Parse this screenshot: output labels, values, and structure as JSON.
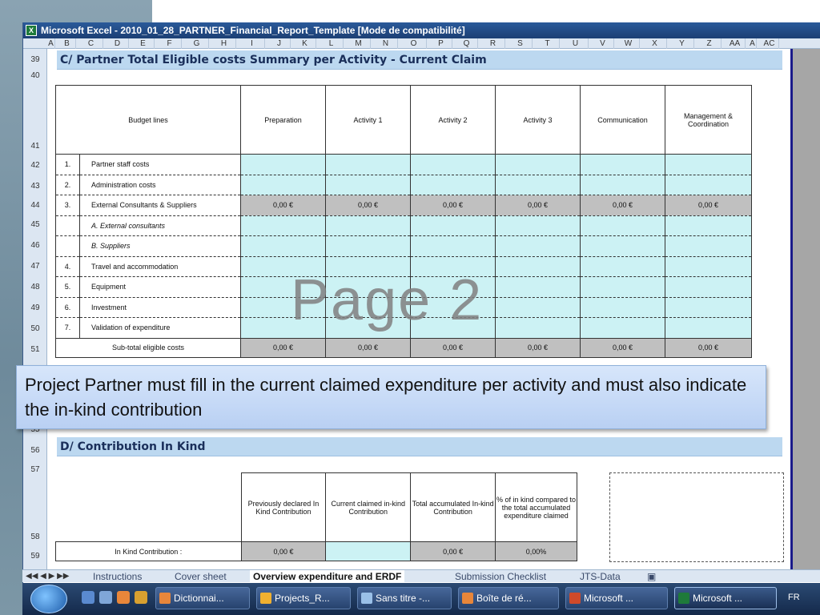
{
  "window": {
    "title": "Microsoft Excel - 2010_01_28_PARTNER_Financial_Report_Template  [Mode de compatibilité]"
  },
  "columns": [
    "A",
    "B",
    "C",
    "D",
    "E",
    "F",
    "G",
    "H",
    "I",
    "J",
    "K",
    "L",
    "M",
    "N",
    "O",
    "P",
    "Q",
    "R",
    "S",
    "T",
    "U",
    "V",
    "W",
    "X",
    "Y",
    "Z",
    "AA",
    "A",
    "AC"
  ],
  "rows": [
    "39",
    "40",
    "41",
    "42",
    "43",
    "44",
    "45",
    "46",
    "47",
    "48",
    "49",
    "50",
    "51",
    "55",
    "56",
    "57",
    "58",
    "59"
  ],
  "section_c": {
    "title": "C/ Partner Total Eligible costs Summary per Activity - Current Claim",
    "headers": [
      "Budget lines",
      "Preparation",
      "Activity 1",
      "Activity 2",
      "Activity 3",
      "Communication",
      "Management & Coordination"
    ],
    "lines": [
      {
        "num": "1.",
        "label": "Partner staff costs"
      },
      {
        "num": "2.",
        "label": "Administration costs"
      },
      {
        "num": "3.",
        "label": "External Consultants & Suppliers"
      },
      {
        "num": "",
        "label": "A. External consultants"
      },
      {
        "num": "",
        "label": "B. Suppliers"
      },
      {
        "num": "4.",
        "label": "Travel and accommodation"
      },
      {
        "num": "5.",
        "label": "Equipment"
      },
      {
        "num": "6.",
        "label": "Investment"
      },
      {
        "num": "7.",
        "label": "Validation of expenditure"
      }
    ],
    "subtotal_label": "Sub-total eligible costs",
    "value": "0,00 €"
  },
  "watermark": "Page 2",
  "callout": "Project Partner must fill in the current claimed expenditure per activity and must also indicate the in-kind contribution",
  "section_d": {
    "title": "D/ Contribution In Kind",
    "headers": [
      "Previously declared In Kind Contribution",
      "Current claimed in-kind Contribution",
      "Total accumulated In-kind Contribution",
      "% of in kind compared to the total accumulated expenditure claimed"
    ],
    "row_label": "In Kind Contribution :",
    "values": [
      "0,00 €",
      "",
      "0,00 €",
      "0,00%"
    ]
  },
  "sheet_tabs": [
    "Instructions",
    "Cover sheet",
    "Overview expenditure and ERDF",
    "Submission Checklist",
    "JTS-Data"
  ],
  "active_tab": "Overview expenditure and ERDF",
  "taskbar": {
    "buttons": [
      "Dictionnai...",
      "Projects_R...",
      "Sans titre -...",
      "Boîte de ré...",
      "Microsoft ...",
      "Microsoft ..."
    ],
    "language": "FR"
  }
}
